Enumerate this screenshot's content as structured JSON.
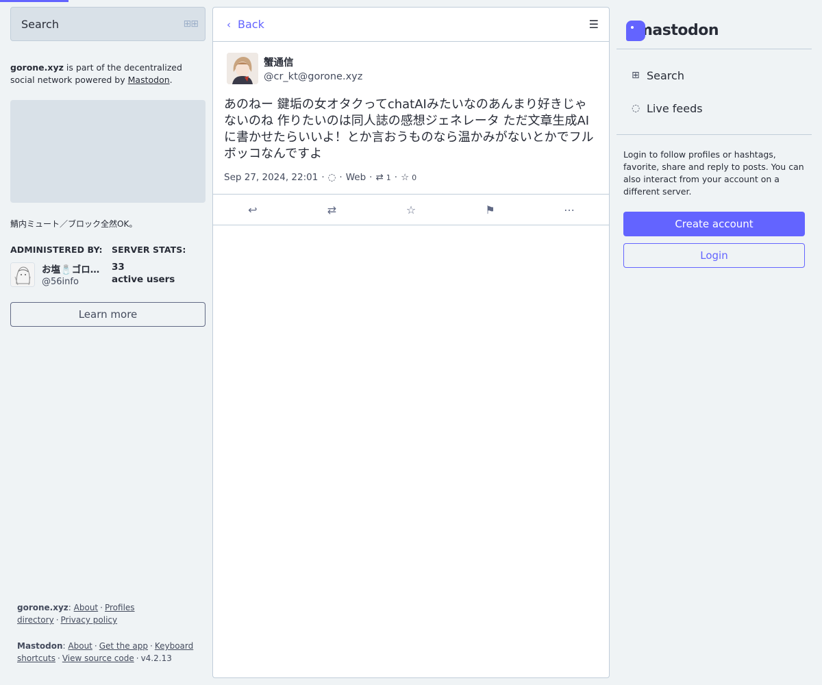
{
  "left": {
    "search": {
      "label": "Search",
      "icon": "grid-icon"
    },
    "about": {
      "server": "gorone.xyz",
      "middle": " is part of the decentralized social network powered by ",
      "link": "Mastodon",
      "end": "."
    },
    "server_description": "鯖内ミュート／ブロック全然OK。",
    "admin": {
      "heading": "ADMINISTERED BY:",
      "name": "お塩🧂ゴロ…",
      "handle": "@56info"
    },
    "stats": {
      "heading": "SERVER STATS:",
      "value": "33",
      "label": "active users"
    },
    "learn_more": "Learn more",
    "footer": {
      "server": "gorone.xyz",
      "about": "About",
      "profiles": "Profiles directory",
      "privacy": "Privacy policy",
      "mastodon": "Mastodon",
      "m_about": "About",
      "get_app": "Get the app",
      "keyboard": "Keyboard shortcuts",
      "source": "View source code",
      "version": "v4.2.13"
    }
  },
  "center": {
    "back": "Back",
    "status": {
      "display_name": "蟹通信",
      "handle": "@cr_kt@gorone.xyz",
      "content": "あのねー 鍵垢の女オタクってchatAIみたいなのあんまり好きじゃないのね 作りたいのは同人誌の感想ジェネレータ ただ文章生成AIに書かせたらいいよ！とか言おうものなら温かみがないとかでフルボッコなんですよ",
      "date": "Sep 27, 2024, 22:01",
      "application": "Web",
      "reblogs": "1",
      "favourites": "0"
    }
  },
  "right": {
    "logo": "mastodon",
    "nav": {
      "search": "Search",
      "live": "Live feeds"
    },
    "login_info": "Login to follow profiles or hashtags, favorite, share and reply to posts. You can also interact from your account on a different server.",
    "create_account": "Create account",
    "login": "Login"
  },
  "colors": {
    "accent": "#6364ff",
    "background": "#eff3f5",
    "panel": "#ffffff"
  }
}
